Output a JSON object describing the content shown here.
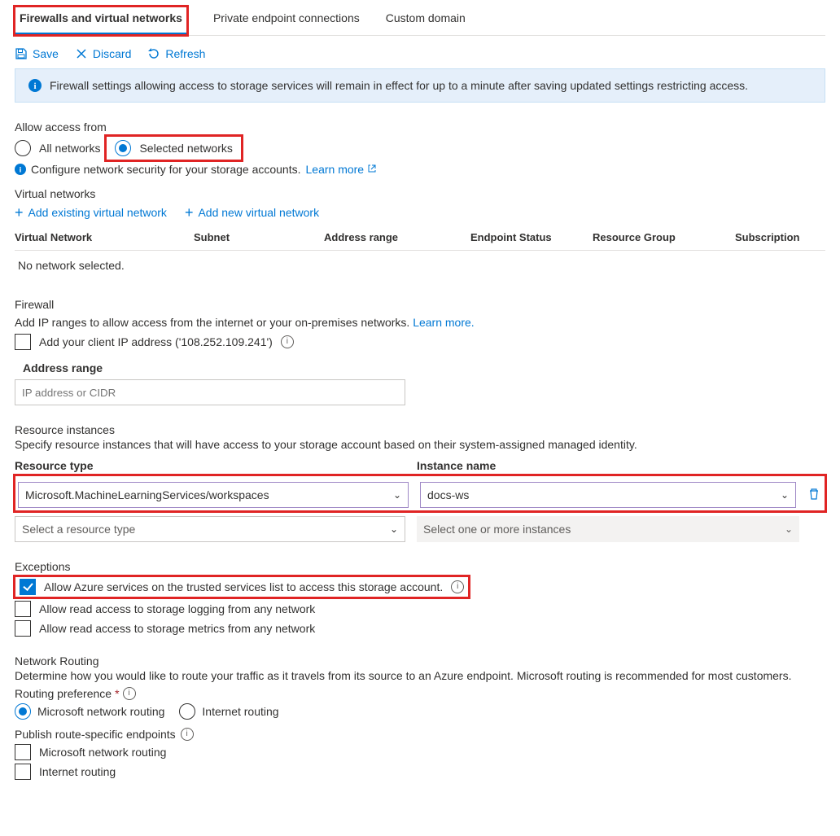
{
  "tabs": {
    "firewalls": "Firewalls and virtual networks",
    "private": "Private endpoint connections",
    "custom": "Custom domain"
  },
  "toolbar": {
    "save": "Save",
    "discard": "Discard",
    "refresh": "Refresh"
  },
  "info_banner": "Firewall settings allowing access to storage services will remain in effect for up to a minute after saving updated settings restricting access.",
  "access": {
    "title": "Allow access from",
    "all": "All networks",
    "selected": "Selected networks",
    "configure_prefix": "Configure network security for your storage accounts.",
    "learn_more": "Learn more"
  },
  "vnets": {
    "title": "Virtual networks",
    "add_existing": "Add existing virtual network",
    "add_new": "Add new virtual network",
    "headers": {
      "network": "Virtual Network",
      "subnet": "Subnet",
      "range": "Address range",
      "status": "Endpoint Status",
      "rg": "Resource Group",
      "sub": "Subscription"
    },
    "empty": "No network selected."
  },
  "firewall": {
    "title": "Firewall",
    "desc": "Add IP ranges to allow access from the internet or your on-premises networks.",
    "learn_more": "Learn more.",
    "add_client": "Add your client IP address ('108.252.109.241')",
    "range_label": "Address range",
    "range_placeholder": "IP address or CIDR"
  },
  "resource_instances": {
    "title": "Resource instances",
    "desc": "Specify resource instances that will have access to your storage account based on their system-assigned managed identity.",
    "col_type": "Resource type",
    "col_instance": "Instance name",
    "rows": [
      {
        "type": "Microsoft.MachineLearningServices/workspaces",
        "instance": "docs-ws"
      }
    ],
    "placeholder_type": "Select a resource type",
    "placeholder_instance": "Select one or more instances"
  },
  "exceptions": {
    "title": "Exceptions",
    "e1": "Allow Azure services on the trusted services list to access this storage account.",
    "e2": "Allow read access to storage logging from any network",
    "e3": "Allow read access to storage metrics from any network"
  },
  "routing": {
    "title": "Network Routing",
    "desc": "Determine how you would like to route your traffic as it travels from its source to an Azure endpoint. Microsoft routing is recommended for most customers.",
    "pref_label": "Routing preference",
    "r1": "Microsoft network routing",
    "r2": "Internet routing",
    "publish_label": "Publish route-specific endpoints",
    "p1": "Microsoft network routing",
    "p2": "Internet routing"
  }
}
